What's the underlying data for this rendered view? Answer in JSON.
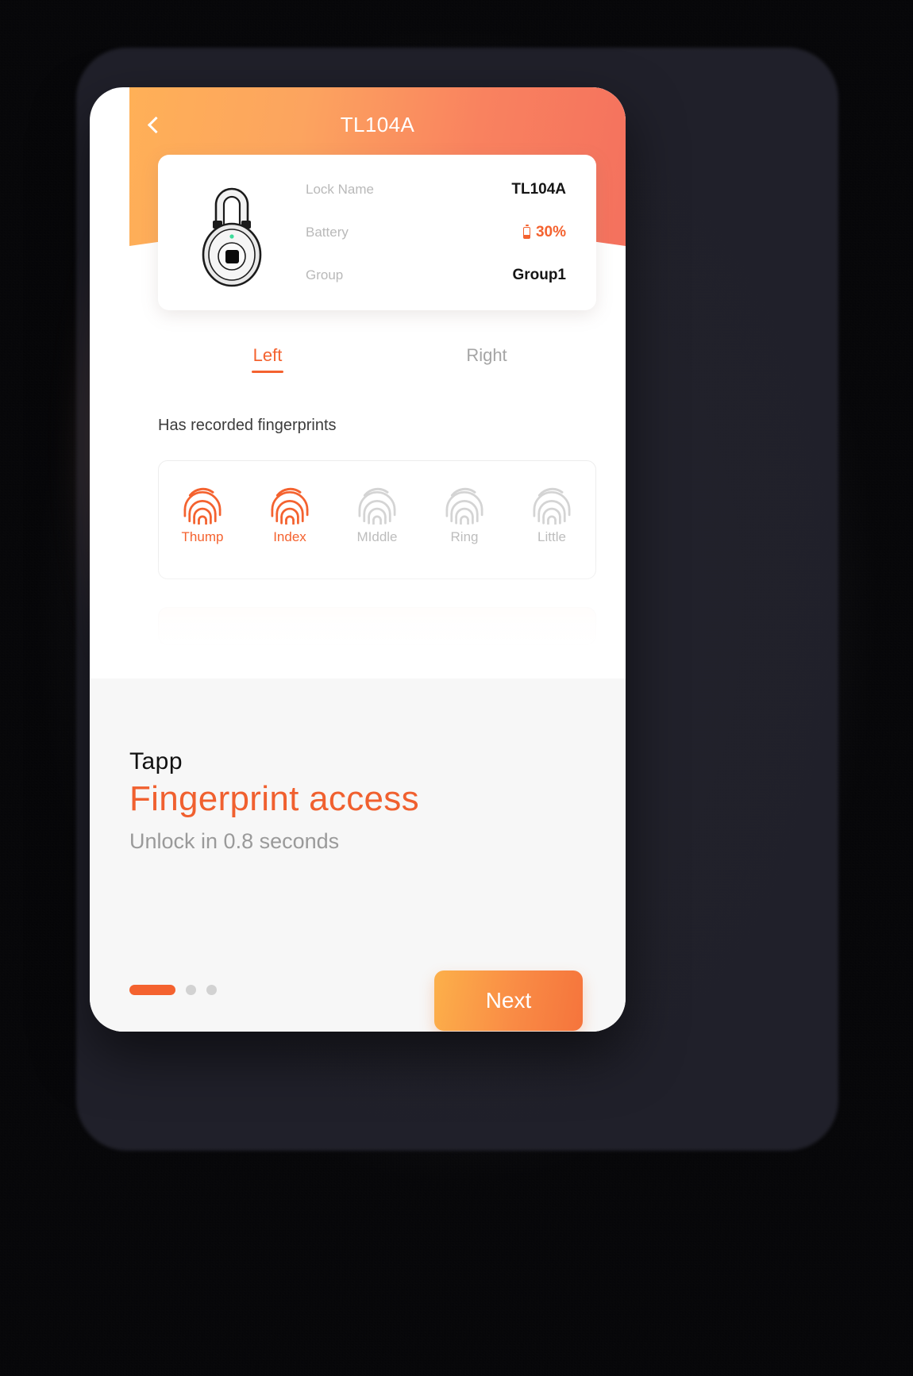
{
  "navbar": {
    "back_icon": "chevron-left-icon",
    "title": "TL104A"
  },
  "lock_card": {
    "icon": "padlock-icon",
    "rows": [
      {
        "label": "Lock Name",
        "value": "TL104A"
      },
      {
        "label": "Battery",
        "value": "30%",
        "icon": "battery-icon"
      },
      {
        "label": "Group",
        "value": "Group1"
      }
    ]
  },
  "tabs": [
    {
      "label": "Left",
      "active": true
    },
    {
      "label": "Right",
      "active": false
    }
  ],
  "fingerprints": {
    "section_title": "Has recorded fingerprints",
    "items": [
      {
        "label": "Thump",
        "recorded": true
      },
      {
        "label": "Index",
        "recorded": true
      },
      {
        "label": "MIddle",
        "recorded": false
      },
      {
        "label": "Ring",
        "recorded": false
      },
      {
        "label": "Little",
        "recorded": false
      }
    ]
  },
  "sheet": {
    "brand": "Tapp",
    "headline": "Fingerprint access",
    "subline": "Unlock in 0.8 seconds",
    "pagination": {
      "total": 3,
      "active_index": 0
    },
    "next_label": "Next"
  },
  "colors": {
    "accent": "#f4622f",
    "headline": "#f0602f",
    "header_gradient_start": "#ffb057",
    "header_gradient_end": "#f4715e",
    "button_gradient_start": "#fcb04a",
    "button_gradient_end": "#f5743c",
    "muted_text": "#b9b9b9",
    "sheet_bg": "#f7f7f7",
    "lock_led": "#3ddc9a"
  }
}
